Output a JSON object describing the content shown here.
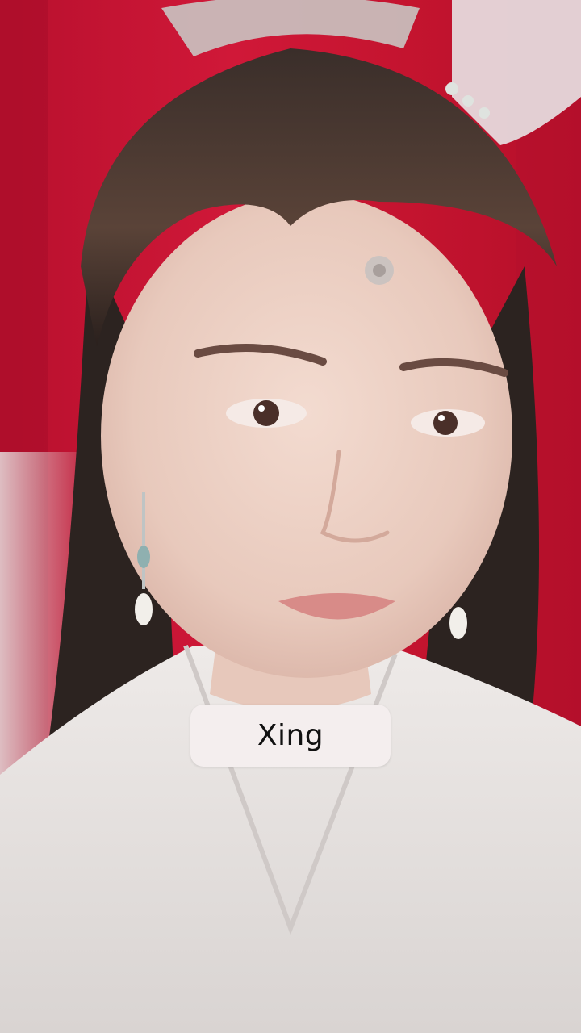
{
  "caption": {
    "text": "Xing"
  },
  "colors": {
    "background_red": "#c8193a",
    "caption_bg": "#f4eeee",
    "caption_text": "#111111",
    "robe": "#e9e4e2",
    "hair": "#2e2522",
    "skin": "#eed3c8"
  }
}
